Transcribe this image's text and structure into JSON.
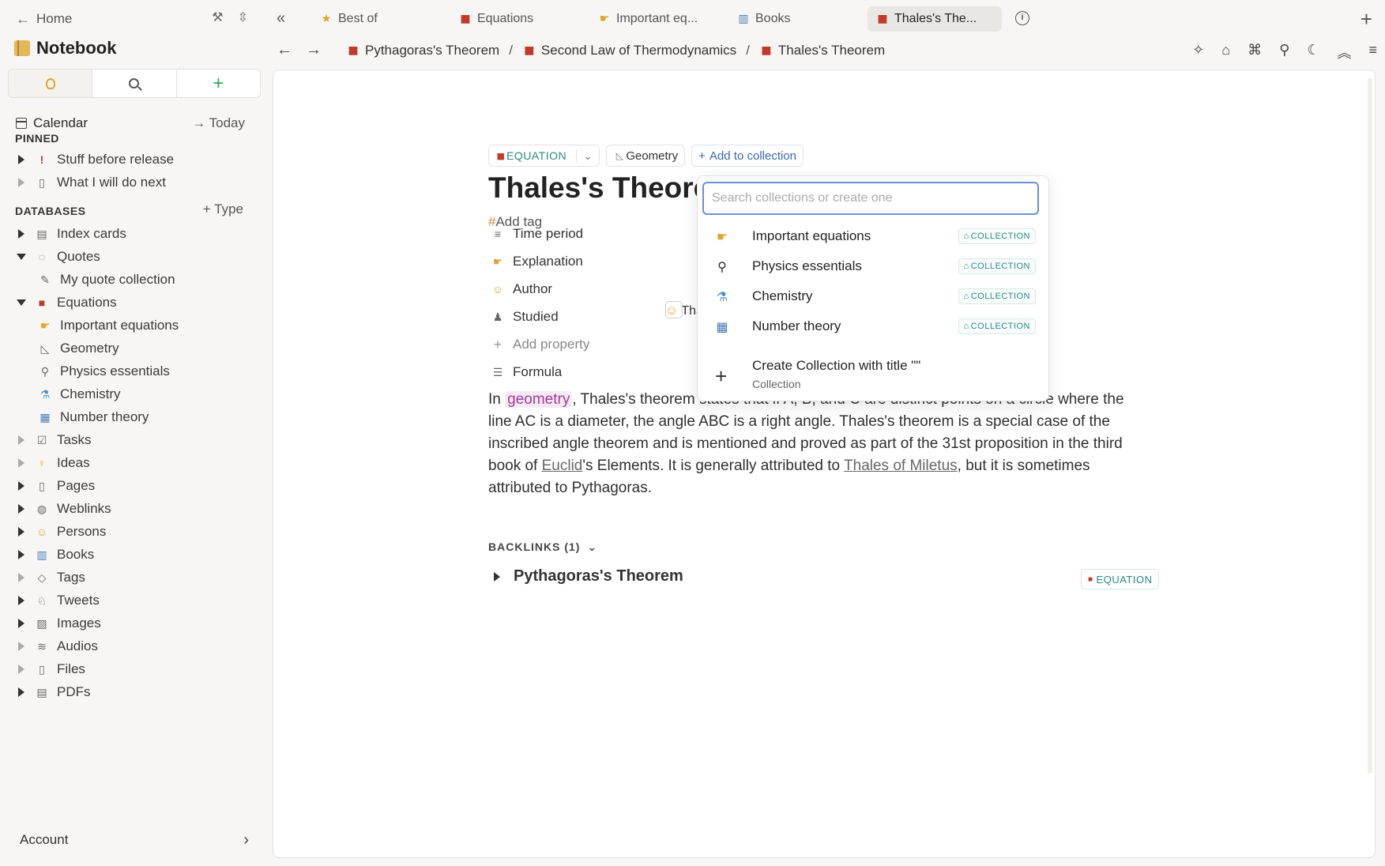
{
  "sidebar": {
    "home_label": "Home",
    "notebook_title": "Notebook",
    "calendar_label": "Calendar",
    "today_label": "Today",
    "pinned_header": "PINNED",
    "pinned": [
      {
        "label": "Stuff before release",
        "icon": "exclamation-icon"
      },
      {
        "label": "What I will do next",
        "icon": "page-icon"
      }
    ],
    "databases_header": "DATABASES",
    "type_button": "Type",
    "databases": [
      {
        "label": "Index cards",
        "icon": "card-box-icon"
      },
      {
        "label": "Quotes",
        "icon": "speech-bubble-icon"
      },
      {
        "label": "My quote collection",
        "icon": "collection-icon"
      },
      {
        "label": "Equations",
        "icon": "book-icon"
      },
      {
        "label": "Important equations",
        "icon": "pointing-hand-icon"
      },
      {
        "label": "Geometry",
        "icon": "triangle-ruler-icon"
      },
      {
        "label": "Physics essentials",
        "icon": "telescope-icon"
      },
      {
        "label": "Chemistry",
        "icon": "flask-icon"
      },
      {
        "label": "Number theory",
        "icon": "numbers-icon"
      },
      {
        "label": "Tasks",
        "icon": "checkbox-icon"
      },
      {
        "label": "Ideas",
        "icon": "bulb-icon"
      },
      {
        "label": "Pages",
        "icon": "page-icon"
      },
      {
        "label": "Weblinks",
        "icon": "globe-icon"
      },
      {
        "label": "Persons",
        "icon": "person-icon"
      },
      {
        "label": "Books",
        "icon": "open-book-icon"
      },
      {
        "label": "Tags",
        "icon": "tag-icon"
      },
      {
        "label": "Tweets",
        "icon": "bird-icon"
      },
      {
        "label": "Images",
        "icon": "image-icon"
      },
      {
        "label": "Audios",
        "icon": "waveform-icon"
      },
      {
        "label": "Files",
        "icon": "file-icon"
      },
      {
        "label": "PDFs",
        "icon": "pdf-icon"
      }
    ],
    "account_label": "Account"
  },
  "tabs": [
    {
      "label": "Best of",
      "icon": "star-icon"
    },
    {
      "label": "Equations",
      "icon": "book-icon"
    },
    {
      "label": "Important eq...",
      "icon": "pointing-hand-icon"
    },
    {
      "label": "Books",
      "icon": "open-book-icon"
    },
    {
      "label": "Thales's The...",
      "icon": "book-icon",
      "active": true
    }
  ],
  "breadcrumbs": [
    {
      "label": "Pythagoras's Theorem"
    },
    {
      "label": "Second Law of Thermodynamics"
    },
    {
      "label": "Thales's Theorem"
    }
  ],
  "breadcrumb_separator": "/",
  "page": {
    "type_chip": "EQUATION",
    "collection_chip": "Geometry",
    "add_collection": "Add to collection",
    "title": "Thales's Theorem",
    "add_tag": "Add tag",
    "properties": {
      "time_period": "Time period",
      "explanation": "Explanation",
      "author": "Author",
      "author_value": "Thales of Miletus",
      "studied": "Studied",
      "add_property": "Add property",
      "formula": "Formula"
    },
    "body": {
      "p1": "In ",
      "highlight": "geometry",
      "p2": ", Thales's theorem states that if A, B, and C are distinct points on a circle where the line AC is a diameter, the angle ABC is a right angle. Thales's theorem is a special case of the inscribed angle theorem and is mentioned and proved as part of the 31st proposition in the third book of ",
      "link1": "Euclid",
      "p3": "'s Elements. It is generally attributed to ",
      "link2": "Thales of Miletus",
      "p4": ", but it is sometimes attributed to Pythagoras."
    },
    "backlinks_header": "BACKLINKS (1)",
    "backlink_title": "Pythagoras's Theorem",
    "backlink_badge": "EQUATION"
  },
  "dropdown": {
    "placeholder": "Search collections or create one",
    "items": [
      {
        "label": "Important equations",
        "tag": "COLLECTION",
        "icon": "pointing-hand-icon"
      },
      {
        "label": "Physics essentials",
        "tag": "COLLECTION",
        "icon": "telescope-icon"
      },
      {
        "label": "Chemistry",
        "tag": "COLLECTION",
        "icon": "flask-icon"
      },
      {
        "label": "Number theory",
        "tag": "COLLECTION",
        "icon": "numbers-icon"
      }
    ],
    "create_title": "Create Collection with title \"\"",
    "create_sub": "Collection"
  },
  "colors": {
    "accent_teal": "#2a8a85",
    "link_blue": "#3a68b0",
    "highlight_pink": "#a2399a"
  }
}
